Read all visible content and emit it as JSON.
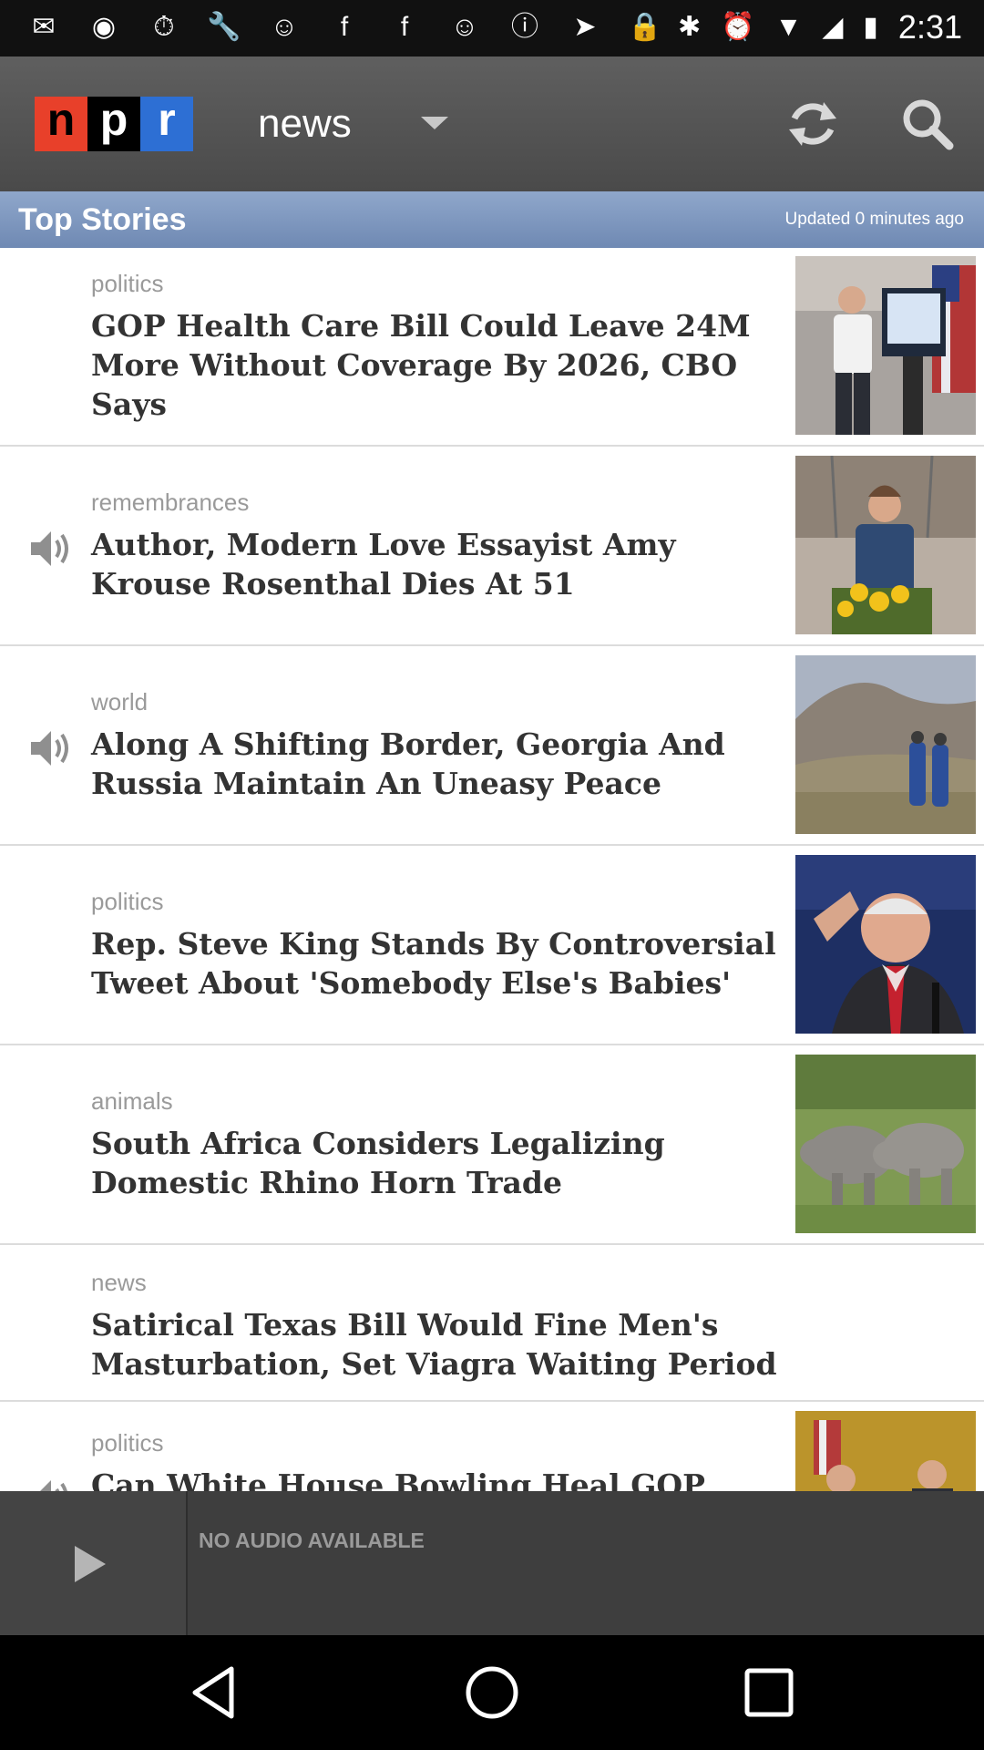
{
  "status_bar": {
    "time": "2:31",
    "left_icons": [
      "messages-icon",
      "record-icon",
      "timer-icon",
      "wrench-icon",
      "smiley-icon",
      "facebook-icon",
      "facebook-icon",
      "smiley-icon",
      "info-icon",
      "fake-gps-icon",
      "lock-icon"
    ],
    "right_icons": [
      "bluetooth-icon",
      "alarm-icon",
      "wifi-icon",
      "signal-icon",
      "battery-icon"
    ]
  },
  "app_bar": {
    "logo_letters": [
      "n",
      "p",
      "r"
    ],
    "section": "news",
    "accent_red": "#e8402a",
    "accent_blue": "#2d6fd4"
  },
  "top_bar": {
    "title": "Top Stories",
    "updated": "Updated 0 minutes ago"
  },
  "stories": [
    {
      "category": "politics",
      "headline": "GOP Health Care Bill Could Leave 24M More Without Coverage By 2026, CBO Says",
      "audio": false,
      "image": "man-with-screen-photo"
    },
    {
      "category": "remembrances",
      "headline": "Author, Modern Love Essayist Amy Krouse Rosenthal Dies At 51",
      "audio": true,
      "image": "woman-with-flowers-photo"
    },
    {
      "category": "world",
      "headline": "Along A Shifting Border, Georgia And Russia Maintain An Uneasy Peace",
      "audio": true,
      "image": "border-landscape-photo"
    },
    {
      "category": "politics",
      "headline": "Rep. Steve King Stands By Controversial Tweet About 'Somebody Else's Babies'",
      "audio": false,
      "image": "congressman-photo"
    },
    {
      "category": "animals",
      "headline": "South Africa Considers Legalizing Domestic Rhino Horn Trade",
      "audio": false,
      "image": "rhinos-photo"
    },
    {
      "category": "news",
      "headline": "Satirical Texas Bill Would Fine Men's Masturbation, Set Viagra Waiting Period",
      "audio": false,
      "image": ""
    },
    {
      "category": "politics",
      "headline": "Can White House Bowling Heal GOP",
      "audio": true,
      "image": "white-house-photo"
    }
  ],
  "player": {
    "status": "NO AUDIO AVAILABLE"
  }
}
